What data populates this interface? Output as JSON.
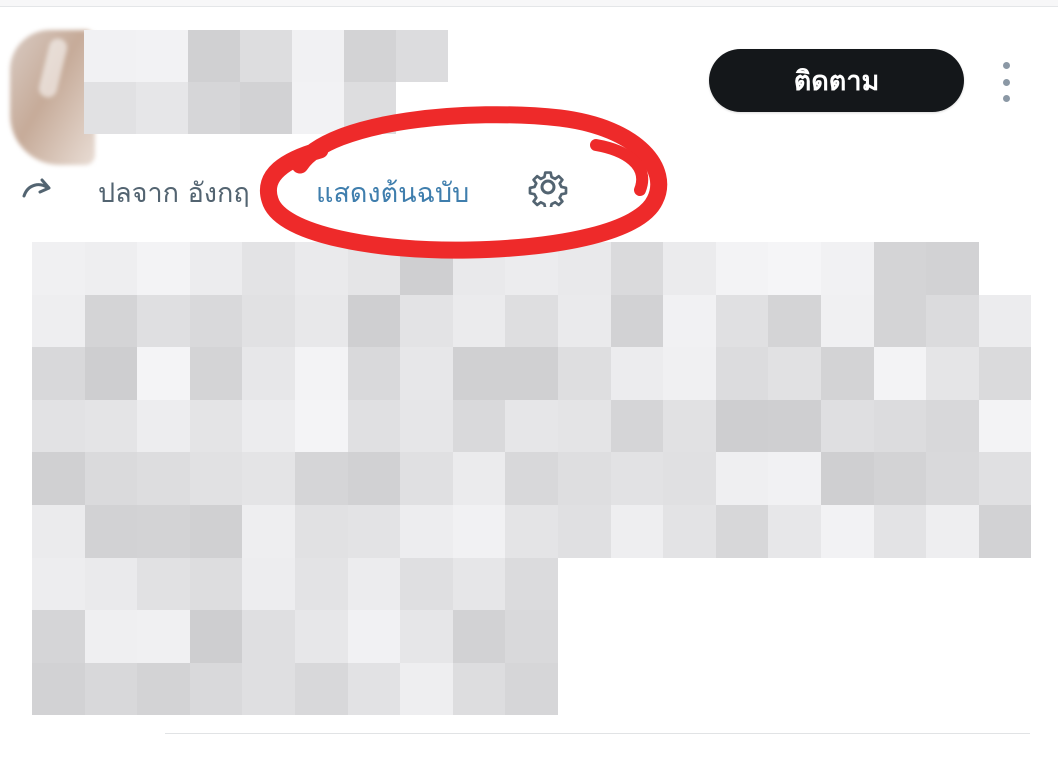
{
  "header": {
    "follow_label": "ติดตาม",
    "more_icon": "more-vertical-icon"
  },
  "translation_bar": {
    "translated_from_label": "ปลจาก อังกฤ",
    "show_original_label": "แสดงต้นฉบับ",
    "settings_icon": "gear-icon",
    "globe_icon": "globe-icon"
  },
  "colors": {
    "follow_button_bg": "#14171a",
    "link_blue": "#3f7ead",
    "muted_text": "#536471",
    "annotation_red": "#ee2a2a"
  }
}
